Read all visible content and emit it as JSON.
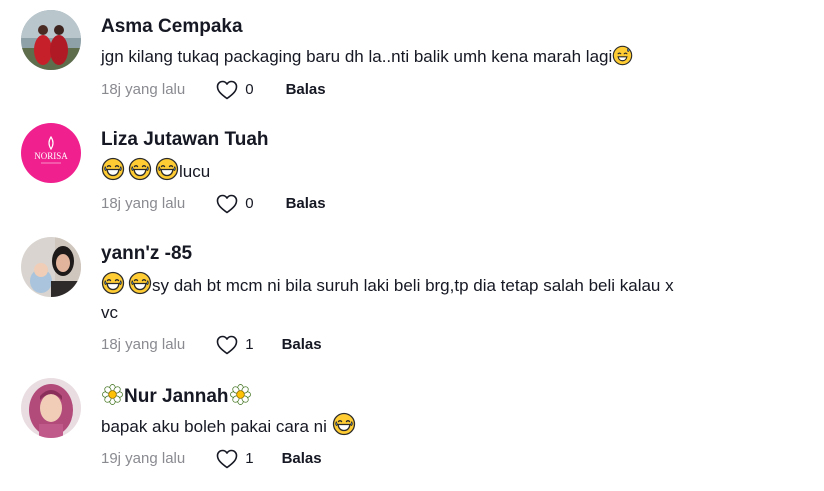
{
  "comments": [
    {
      "username": "Asma Cempaka",
      "text": "jgn kilang tukaq packaging baru dh la..nti balik umh kena marah lagi",
      "text_emoji_after": "sweat-smile-emoji",
      "time": "18j yang lalu",
      "likes": "0",
      "reply_label": "Balas",
      "avatar": "photo-two-people-red-dress"
    },
    {
      "username": "Liza Jutawan Tuah",
      "text_emoji_before": [
        "laughing-tears-emoji",
        "laughing-tears-emoji",
        "laughing-tears-emoji"
      ],
      "text": "lucu",
      "time": "18j yang lalu",
      "likes": "0",
      "reply_label": "Balas",
      "avatar": "pink-logo",
      "avatar_logo": "NORISA",
      "avatar_accent": "#f0208e"
    },
    {
      "username": "yann'z -85",
      "text_emoji_before": [
        "laughing-tears-emoji",
        "laughing-tears-emoji"
      ],
      "text_line1": "sy dah bt mcm ni bila suruh laki beli brg,tp dia tetap salah beli kalau x",
      "text_line2": "vc",
      "time": "18j yang lalu",
      "likes": "1",
      "reply_label": "Balas",
      "avatar": "photo-woman-with-child"
    },
    {
      "username": "Nur Jannah",
      "username_decor": "daisy-flower-emoji",
      "text": "bapak aku boleh pakai cara ni ",
      "text_emoji_after": "laughing-tears-emoji",
      "time": "19j yang lalu",
      "likes": "1",
      "reply_label": "Balas",
      "avatar": "photo-woman-pink-hijab"
    }
  ],
  "colors": {
    "primary_text": "#161823",
    "secondary_text": "#8a8b91",
    "background": "#ffffff"
  }
}
